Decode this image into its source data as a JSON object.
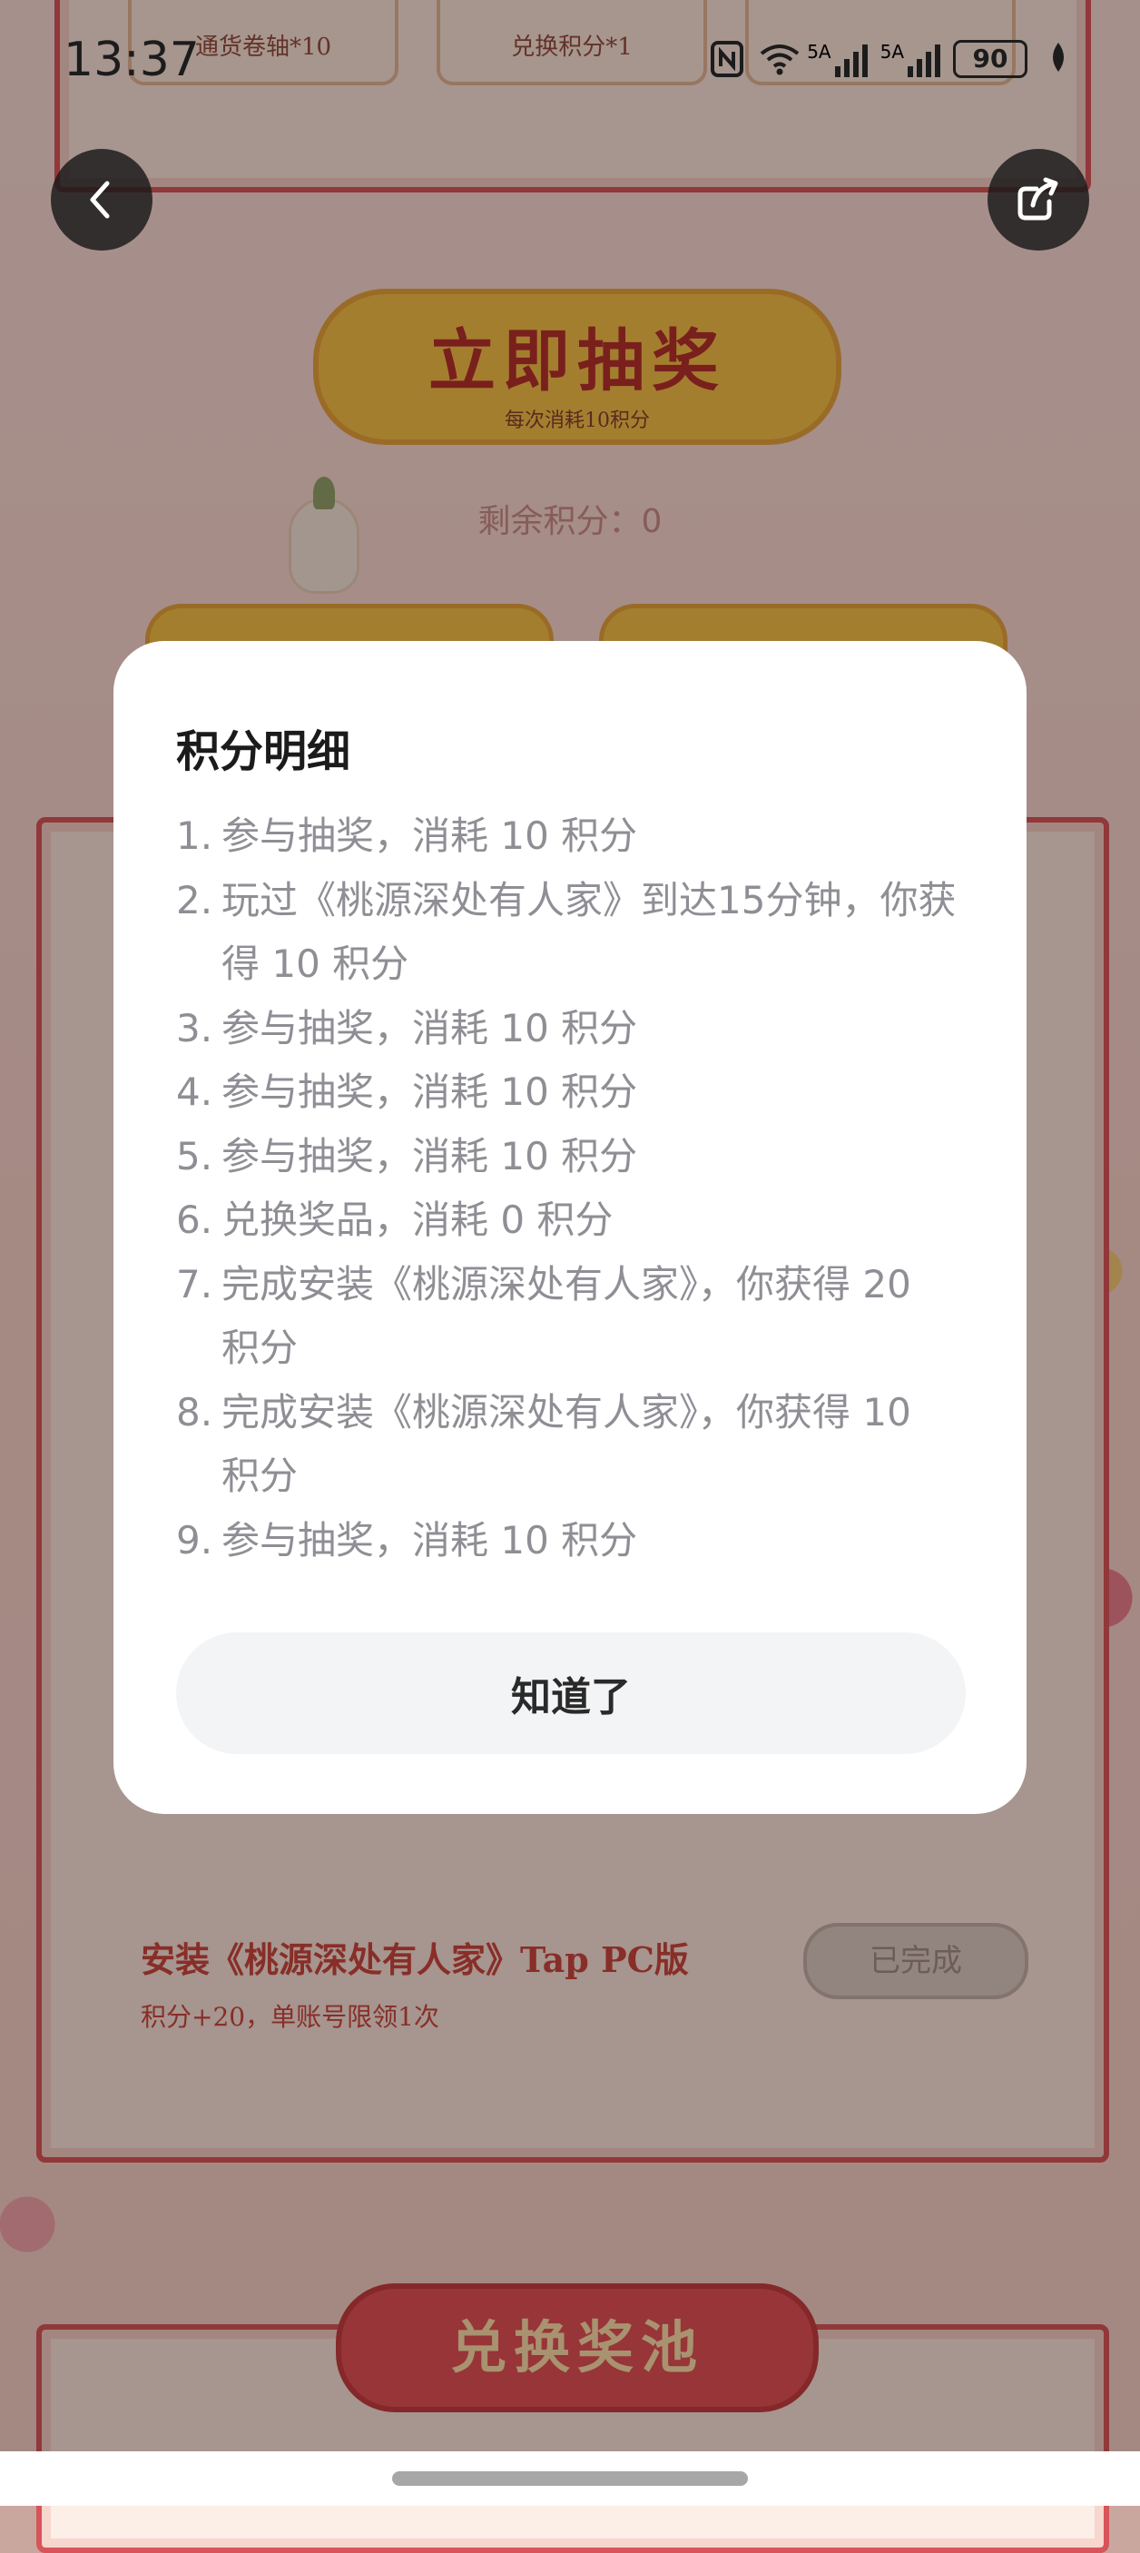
{
  "status_bar": {
    "time": "13:37",
    "network_label": "5A",
    "network_label_2": "5A",
    "wifi_tag": "7",
    "battery": "90"
  },
  "background": {
    "top_cards": [
      "通货卷轴*10",
      "兑换积分*1",
      ""
    ],
    "draw_button": {
      "title": "立即抽奖",
      "subtitle": "每次消耗10积分"
    },
    "remaining_points": "剩余积分：0",
    "task": {
      "title": "安装《桃源深处有人家》Tap PC版",
      "subtitle": "积分+20，单账号限领1次",
      "status": "已完成"
    },
    "pool_title": "兑换奖池"
  },
  "dialog": {
    "title": "积分明细",
    "items": [
      {
        "num": "1.",
        "text": "参与抽奖，消耗 10 积分"
      },
      {
        "num": "2.",
        "text": "玩过《桃源深处有人家》到达15分钟，你获得 10 积分"
      },
      {
        "num": "3.",
        "text": "参与抽奖，消耗 10 积分"
      },
      {
        "num": "4.",
        "text": "参与抽奖，消耗 10 积分"
      },
      {
        "num": "5.",
        "text": "参与抽奖，消耗 10 积分"
      },
      {
        "num": "6.",
        "text": "兑换奖品，消耗 0 积分"
      },
      {
        "num": "7.",
        "text": "完成安装《桃源深处有人家》，你获得 20 积分"
      },
      {
        "num": "8.",
        "text": "完成安装《桃源深处有人家》，你获得 10 积分"
      },
      {
        "num": "9.",
        "text": "参与抽奖，消耗 10 积分"
      }
    ],
    "confirm_label": "知道了"
  },
  "colors": {
    "overlay": "#280e0a",
    "accent_red": "#c8433c",
    "dialog_bg": "#ffffff",
    "list_text": "#8e8e95"
  }
}
